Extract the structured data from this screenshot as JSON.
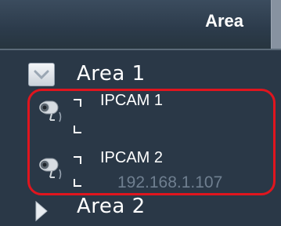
{
  "panel": {
    "header_title": "Area"
  },
  "tree": {
    "areas": [
      {
        "label": "Area 1",
        "expanded": true,
        "icon": "chevron-down-icon",
        "cameras": [
          {
            "label": "IPCAM 1",
            "ip": "",
            "icon": "security-camera-icon"
          },
          {
            "label": "IPCAM 2",
            "ip": "192.168.1.107",
            "icon": "security-camera-icon"
          }
        ]
      },
      {
        "label": "Area 2",
        "expanded": false,
        "icon": "chevron-right-icon",
        "cameras": []
      }
    ]
  },
  "colors": {
    "background": "#2a3847",
    "header_text": "#ffffff",
    "ip_text": "#6f7f90",
    "highlight_outline": "#e0151e"
  }
}
